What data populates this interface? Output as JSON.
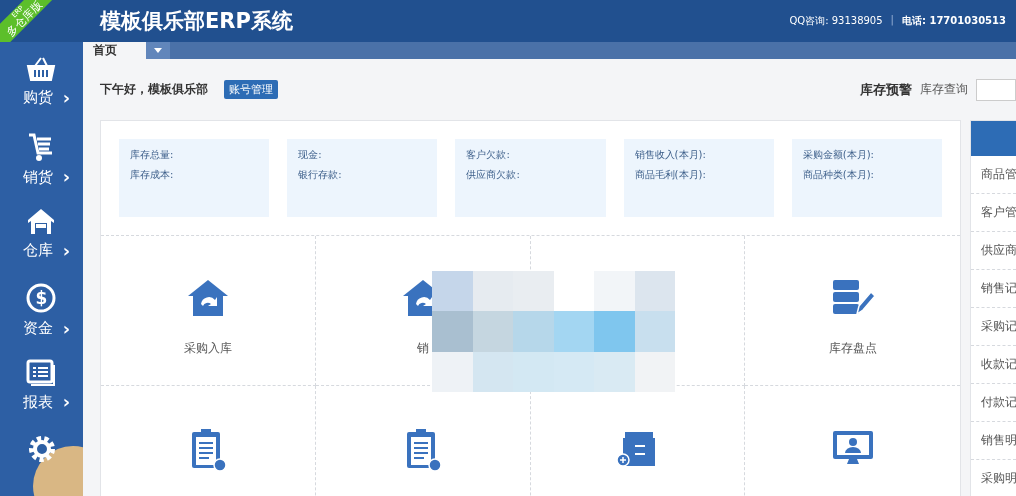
{
  "corner_ribbon": {
    "small": "ERP",
    "label": "多仓库版"
  },
  "header": {
    "title": "模板俱乐部ERP系统",
    "qq_label": "QQ咨询:",
    "qq": "93138905",
    "separator": "|",
    "phone_label": "电话:",
    "phone": "17701030513"
  },
  "sidebar": {
    "items": [
      {
        "kind": "menu",
        "label": "购货",
        "chevron": "›"
      },
      {
        "kind": "menu",
        "label": "销货",
        "chevron": "›"
      },
      {
        "kind": "menu",
        "label": "仓库",
        "chevron": "›"
      },
      {
        "kind": "menu",
        "label": "资金",
        "chevron": "›",
        "symbol": "$"
      },
      {
        "kind": "menu",
        "label": "报表",
        "chevron": "›"
      },
      {
        "kind": "settings"
      }
    ]
  },
  "tabs": [
    {
      "label": "首页",
      "selected": true
    }
  ],
  "greeting": {
    "text": "下午好，模板俱乐部",
    "button": "账号管理"
  },
  "top_links": [
    {
      "label": "库存预警",
      "bold": true
    },
    {
      "label": "库存查询",
      "bold": false
    }
  ],
  "stats": [
    {
      "lines": [
        "库存总量:",
        "库存成本:"
      ]
    },
    {
      "lines": [
        "现金:",
        "银行存款:"
      ]
    },
    {
      "lines": [
        "客户欠款:",
        "供应商欠款:"
      ]
    },
    {
      "lines": [
        "销售收入(本月):",
        "商品毛利(本月):"
      ]
    },
    {
      "lines": [
        "采购金额(本月):",
        "商品种类(本月):"
      ]
    }
  ],
  "tiles": [
    {
      "kind": "shortcut",
      "label": "采购入库"
    },
    {
      "kind": "shortcut",
      "label": "销"
    },
    {
      "kind": "covered"
    },
    {
      "kind": "shortcut",
      "label": "库存盘点"
    },
    {
      "kind": "shortcut"
    },
    {
      "kind": "shortcut"
    },
    {
      "kind": "shortcut"
    },
    {
      "kind": "shortcut"
    }
  ],
  "side_list": {
    "items": [
      "商品管",
      "客户管",
      "供应商",
      "销售记",
      "采购记",
      "收款记",
      "付款记",
      "销售明",
      "采购明"
    ]
  }
}
